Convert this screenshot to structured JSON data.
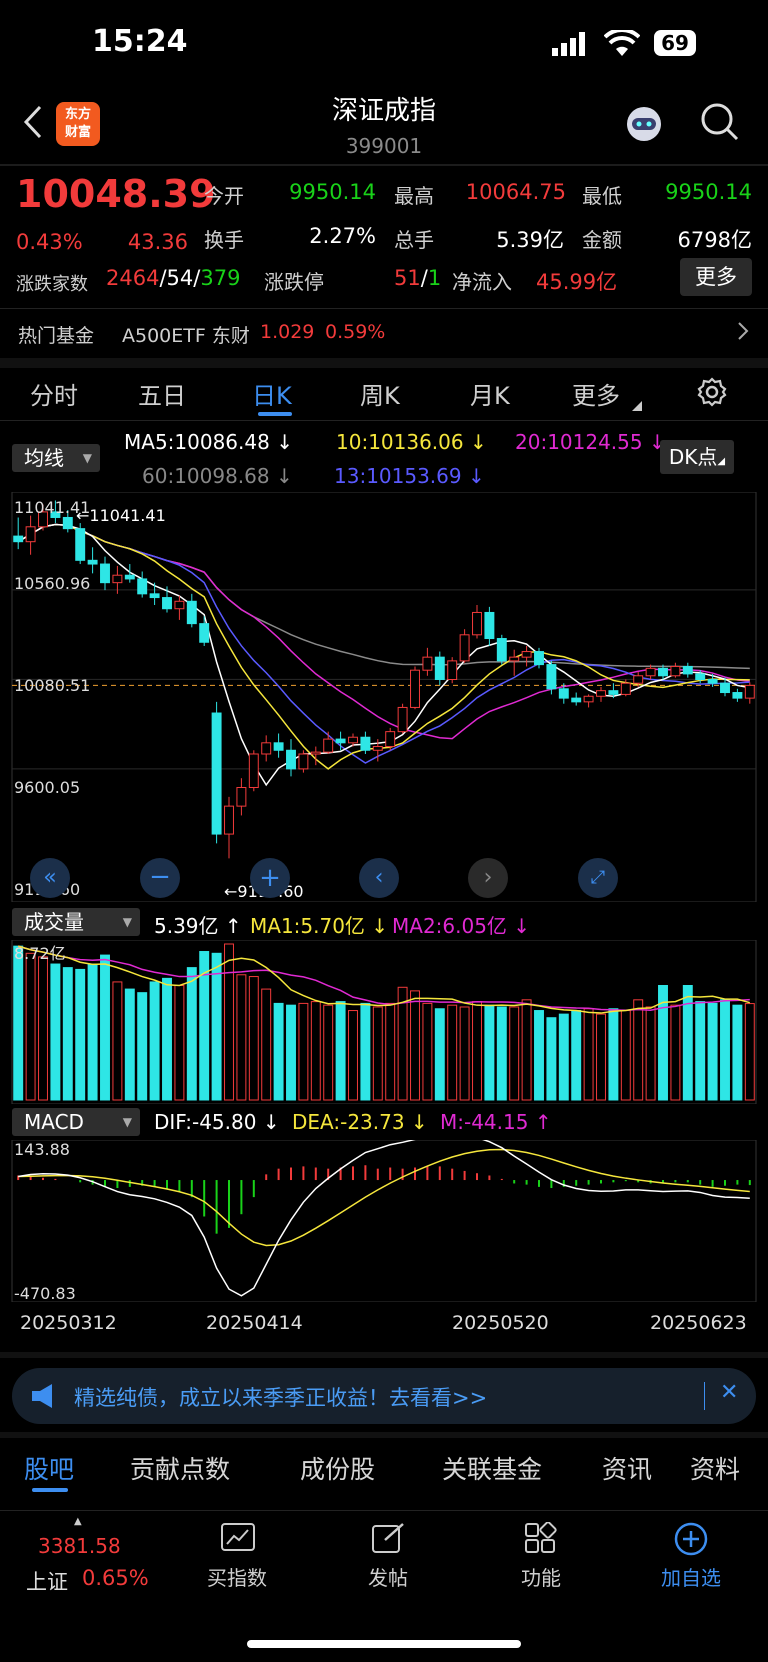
{
  "status": {
    "time": "15:24",
    "battery": "69"
  },
  "header": {
    "title": "深证成指",
    "code": "399001",
    "logo_line1": "东方",
    "logo_line2": "财富"
  },
  "quote": {
    "price": "10048.39",
    "pct": "0.43%",
    "change": "43.36",
    "open_label": "今开",
    "open": "9950.14",
    "high_label": "最高",
    "high": "10064.75",
    "low_label": "最低",
    "low": "9950.14",
    "turnover_label": "换手",
    "turnover": "2.27%",
    "hands_label": "总手",
    "hands": "5.39亿",
    "amount_label": "金额",
    "amount": "6798亿",
    "breadth_label": "涨跌家数",
    "up": "2464",
    "flat": "54",
    "down": "379",
    "limit_label": "涨跌停",
    "limit_up": "51",
    "limit_down": "1",
    "inflow_label": "净流入",
    "inflow": "45.99亿",
    "more": "更多"
  },
  "hot_fund": {
    "label": "热门基金",
    "name": "A500ETF 东财",
    "price": "1.029",
    "pct": "0.59%"
  },
  "period_tabs": [
    "分时",
    "五日",
    "日K",
    "周K",
    "月K",
    "更多"
  ],
  "active_tab": "日K",
  "ma_legend": {
    "selector": "均线",
    "ma5": "MA5:10086.48",
    "ma10": "10:10136.06",
    "ma20": "20:10124.55",
    "ma60": "60:10098.68",
    "ma13": "13:10153.69",
    "dk": "DK点"
  },
  "price_axis": {
    "labels": [
      "11041.41",
      "10560.96",
      "10080.51",
      "9600.05",
      "9119.60"
    ],
    "max_marker": "11041.41",
    "min_marker": "9119.60"
  },
  "volume": {
    "selector": "成交量",
    "vol": "5.39亿",
    "ma1": "MA1:5.70亿",
    "ma2": "MA2:6.05亿",
    "axis_top": "8.72亿"
  },
  "macd": {
    "selector": "MACD",
    "dif": "DIF:-45.80",
    "dea": "DEA:-23.73",
    "m": "M:-44.15",
    "axis_top": "143.88",
    "axis_bottom": "-470.83"
  },
  "dates": [
    "20250312",
    "20250414",
    "20250520",
    "20250623"
  ],
  "banner": {
    "text": "精选纯债，成立以来季季正收益！去看看>>"
  },
  "bottom_tabs": [
    "股吧",
    "贡献点数",
    "成份股",
    "关联基金",
    "资讯",
    "资料"
  ],
  "bottom_nav": {
    "index_value": "3381.58",
    "index_name": "上证",
    "index_pct": "0.65%",
    "items": [
      "买指数",
      "发帖",
      "功能",
      "加自选"
    ]
  },
  "colors": {
    "up": "#f23b3b",
    "down": "#19d219",
    "cyan": "#2ee6e6",
    "accent": "#3d8ef0"
  },
  "chart_data": {
    "type": "candlestick",
    "candles": [
      [
        10850,
        10950,
        10780,
        10820
      ],
      [
        10820,
        10960,
        10750,
        10900
      ],
      [
        10900,
        11020,
        10880,
        10980
      ],
      [
        10980,
        11041.41,
        10920,
        10950
      ],
      [
        10950,
        10990,
        10870,
        10890
      ],
      [
        10890,
        10920,
        10700,
        10720
      ],
      [
        10720,
        10790,
        10650,
        10700
      ],
      [
        10700,
        10740,
        10560,
        10600
      ],
      [
        10600,
        10690,
        10540,
        10640
      ],
      [
        10640,
        10700,
        10600,
        10620
      ],
      [
        10620,
        10660,
        10520,
        10540
      ],
      [
        10540,
        10600,
        10480,
        10520
      ],
      [
        10520,
        10580,
        10440,
        10460
      ],
      [
        10460,
        10530,
        10400,
        10500
      ],
      [
        10500,
        10540,
        10360,
        10380
      ],
      [
        10380,
        10420,
        10260,
        10280
      ],
      [
        9900,
        9960,
        9200,
        9250
      ],
      [
        9250,
        9450,
        9119.6,
        9400
      ],
      [
        9400,
        9550,
        9350,
        9500
      ],
      [
        9500,
        9700,
        9480,
        9680
      ],
      [
        9680,
        9780,
        9640,
        9740
      ],
      [
        9740,
        9790,
        9660,
        9700
      ],
      [
        9700,
        9760,
        9560,
        9600
      ],
      [
        9600,
        9700,
        9580,
        9680
      ],
      [
        9680,
        9720,
        9620,
        9690
      ],
      [
        9690,
        9800,
        9680,
        9760
      ],
      [
        9760,
        9800,
        9700,
        9740
      ],
      [
        9740,
        9790,
        9720,
        9770
      ],
      [
        9770,
        9800,
        9680,
        9700
      ],
      [
        9700,
        9760,
        9640,
        9720
      ],
      [
        9720,
        9820,
        9700,
        9800
      ],
      [
        9800,
        9950,
        9790,
        9930
      ],
      [
        9930,
        10150,
        9920,
        10130
      ],
      [
        10130,
        10250,
        10100,
        10200
      ],
      [
        10200,
        10230,
        10050,
        10080
      ],
      [
        10080,
        10200,
        10060,
        10180
      ],
      [
        10180,
        10350,
        10170,
        10320
      ],
      [
        10320,
        10480,
        10300,
        10440
      ],
      [
        10440,
        10470,
        10260,
        10300
      ],
      [
        10300,
        10320,
        10160,
        10180
      ],
      [
        10180,
        10240,
        10100,
        10200
      ],
      [
        10200,
        10260,
        10150,
        10230
      ],
      [
        10230,
        10250,
        10140,
        10160
      ],
      [
        10160,
        10180,
        10000,
        10030
      ],
      [
        10030,
        10060,
        9950,
        9980
      ],
      [
        9980,
        10010,
        9940,
        9960
      ],
      [
        9960,
        10000,
        9930,
        9990
      ],
      [
        9990,
        10040,
        9960,
        10020
      ],
      [
        10020,
        10060,
        9980,
        10000
      ],
      [
        10000,
        10080,
        9990,
        10060
      ],
      [
        10060,
        10120,
        10040,
        10100
      ],
      [
        10100,
        10160,
        10080,
        10140
      ],
      [
        10140,
        10160,
        10080,
        10100
      ],
      [
        10100,
        10170,
        10090,
        10150
      ],
      [
        10150,
        10170,
        10090,
        10110
      ],
      [
        10110,
        10130,
        10060,
        10080
      ],
      [
        10080,
        10110,
        10040,
        10060
      ],
      [
        10060,
        10090,
        9990,
        10010
      ],
      [
        10010,
        10030,
        9960,
        9980
      ],
      [
        9980,
        10064.75,
        9950.14,
        10048.39
      ]
    ],
    "volumes": [
      8.6,
      8.2,
      8.0,
      7.6,
      7.4,
      7.3,
      7.6,
      8.1,
      6.6,
      6.2,
      6.0,
      6.6,
      6.8,
      6.4,
      7.4,
      8.3,
      8.2,
      8.72,
      7.0,
      6.9,
      6.2,
      5.4,
      5.3,
      5.4,
      5.5,
      5.3,
      5.5,
      5.0,
      5.4,
      5.2,
      5.4,
      6.3,
      6.1,
      5.4,
      5.1,
      5.3,
      5.2,
      5.5,
      5.3,
      5.2,
      5.2,
      5.6,
      5.0,
      4.6,
      4.8,
      5.0,
      5.1,
      4.8,
      5.1,
      5.0,
      5.6,
      5.2,
      6.4,
      5.3,
      6.4,
      5.5,
      5.4,
      5.6,
      5.3,
      5.39
    ],
    "macd_hist": [
      40,
      30,
      20,
      10,
      0,
      -20,
      -40,
      -60,
      -70,
      -60,
      -50,
      -60,
      -80,
      -100,
      -150,
      -320,
      -470.83,
      -420,
      -300,
      -150,
      50,
      100,
      110,
      120,
      110,
      100,
      110,
      120,
      130,
      100,
      110,
      100,
      110,
      120,
      120,
      100,
      80,
      60,
      40,
      10,
      -30,
      -40,
      -60,
      -70,
      -60,
      -50,
      -40,
      -30,
      -20,
      -10,
      -20,
      -30,
      -30,
      -20,
      -20,
      -40,
      -60,
      -50,
      -40,
      -44.15
    ]
  }
}
